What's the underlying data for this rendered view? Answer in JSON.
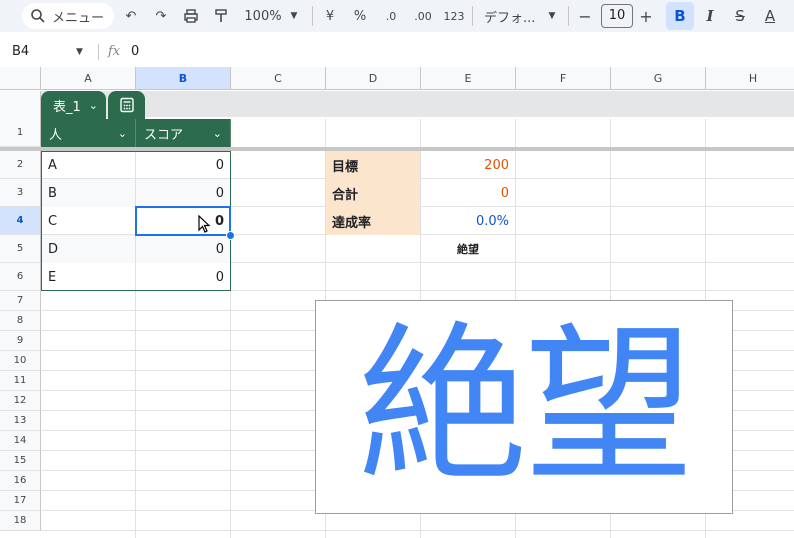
{
  "toolbar": {
    "menu_label": "メニュー",
    "zoom": "100%",
    "currency": "¥",
    "percent": "%",
    "decimal_decrease": ".0",
    "decimal_increase": ".00",
    "number_format": "123",
    "font_name": "デフォ...",
    "font_size": "10",
    "bold": "B",
    "italic": "I",
    "strike": "S",
    "text_color": "A"
  },
  "formula_bar": {
    "cell_ref": "B4",
    "fx": "fx",
    "value": "0"
  },
  "columns": [
    "A",
    "B",
    "C",
    "D",
    "E",
    "F",
    "G",
    "H"
  ],
  "rows": [
    "1",
    "2",
    "3",
    "4",
    "5",
    "6",
    "7",
    "8",
    "9",
    "10",
    "11",
    "12",
    "13",
    "14",
    "15",
    "16",
    "17",
    "18"
  ],
  "table": {
    "name": "表_1",
    "headers": [
      "人",
      "スコア"
    ],
    "rows": [
      {
        "person": "A",
        "score": "0"
      },
      {
        "person": "B",
        "score": "0"
      },
      {
        "person": "C",
        "score": "0"
      },
      {
        "person": "D",
        "score": "0"
      },
      {
        "person": "E",
        "score": "0"
      }
    ]
  },
  "summary": {
    "target_label": "目標",
    "target_value": "200",
    "total_label": "合計",
    "total_value": "0",
    "rate_label": "達成率",
    "rate_value": "0.0%",
    "status_small": "絶望"
  },
  "big_display": {
    "text": "絶望",
    "color": "#4285f4"
  },
  "colors": {
    "table_header": "#2c6b4d",
    "label_fill": "#fce5cd",
    "selection": "#1a73e8"
  }
}
